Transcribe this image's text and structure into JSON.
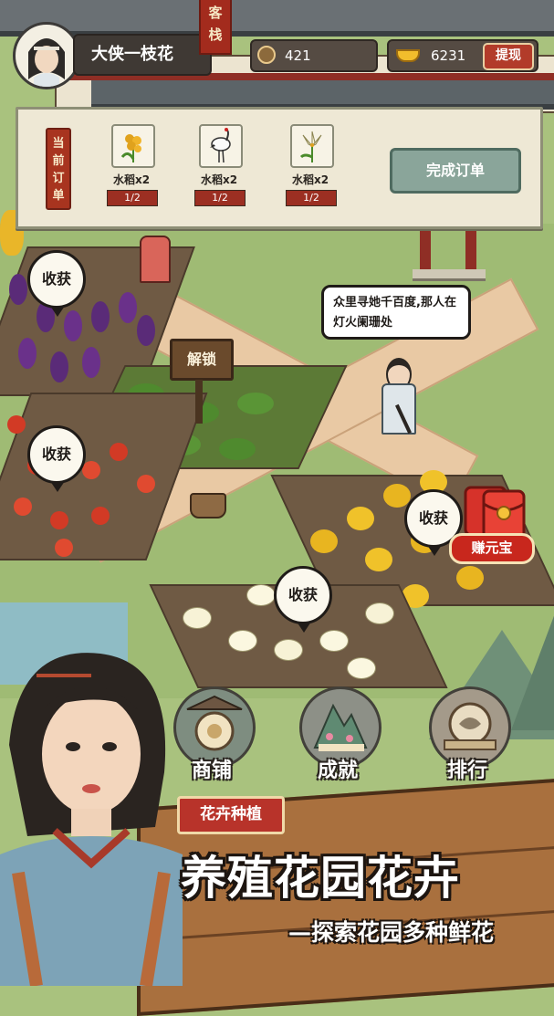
{
  "player": {
    "name": "大侠一枝花"
  },
  "inn_sign": "客栈",
  "resources": {
    "coins": "421",
    "ingots": "6231",
    "withdraw_label": "提现"
  },
  "order": {
    "tag": "当前订单",
    "items": [
      {
        "name": "水稻x2",
        "progress": "1/2",
        "icon": "rice-icon"
      },
      {
        "name": "水稻x2",
        "progress": "1/2",
        "icon": "crane-icon"
      },
      {
        "name": "水稻x2",
        "progress": "1/2",
        "icon": "lily-icon"
      }
    ],
    "complete_label": "完成订单"
  },
  "bubbles": {
    "harvest_eggplant": "收获",
    "harvest_tomato": "收获",
    "harvest_lily": "收获",
    "harvest_osmanthus": "收获"
  },
  "unlock_label": "解锁",
  "speech": "众里寻她千百度,那人在灯火阑珊处",
  "redpacket_label": "赚元宝",
  "nav": {
    "shop": "商铺",
    "achievement": "成就",
    "ranking": "排行"
  },
  "banner": {
    "badge": "花卉种植",
    "headline": "养殖花园花卉",
    "subline": "—探索花园多种鲜花"
  },
  "colors": {
    "accent_red": "#a8341f",
    "panel_bg": "#eee8d5",
    "grass": "#9fbb74",
    "path": "#e9c9a4"
  }
}
